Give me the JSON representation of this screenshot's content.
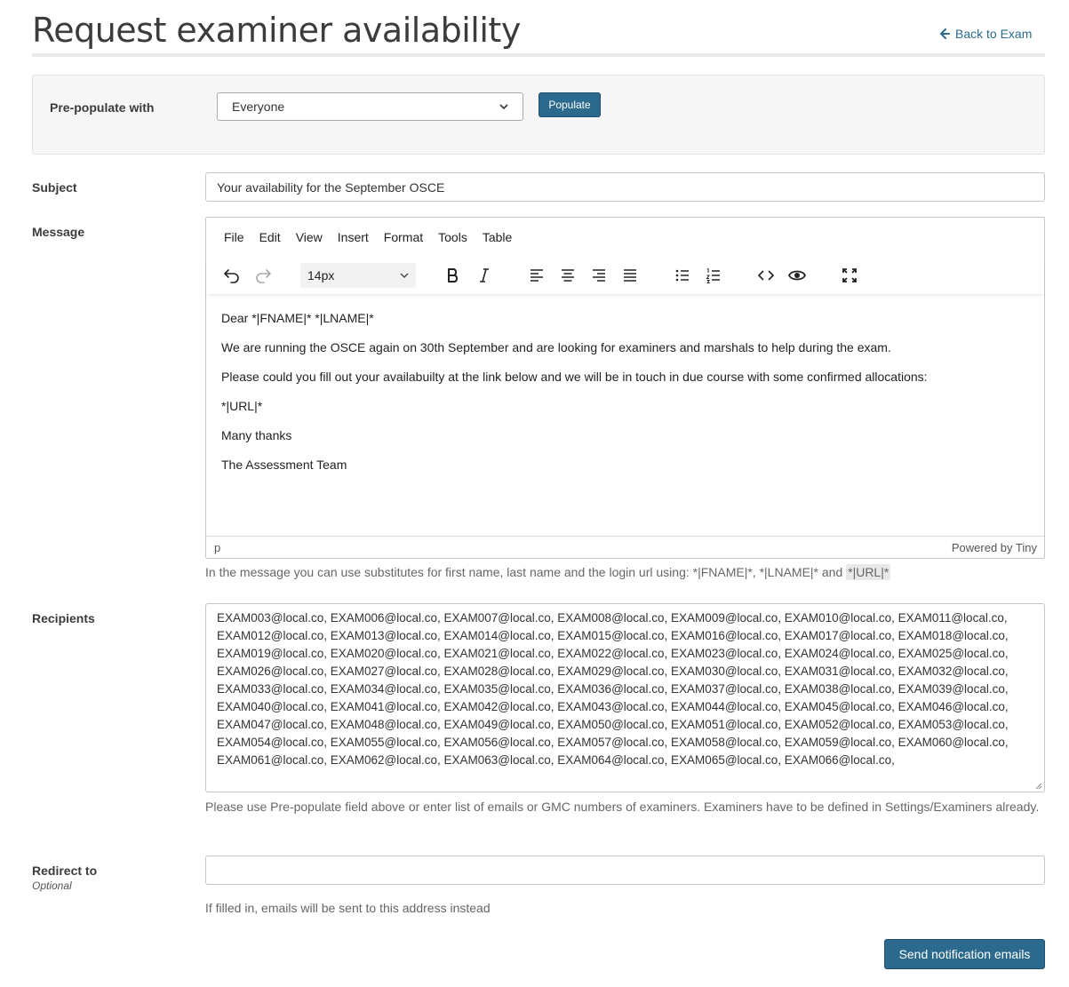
{
  "page": {
    "title": "Request examiner availability",
    "back_link": "Back to Exam"
  },
  "prepopulate": {
    "label": "Pre-populate with",
    "selected": "Everyone",
    "button": "Populate"
  },
  "subject": {
    "label": "Subject",
    "value": "Your availability for the September OSCE"
  },
  "message": {
    "label": "Message",
    "menu": [
      "File",
      "Edit",
      "View",
      "Insert",
      "Format",
      "Tools",
      "Table"
    ],
    "font_size": "14px",
    "paragraphs": [
      "Dear *|FNAME|* *|LNAME|*",
      "We are running the OSCE again on 30th September and are looking for examiners and marshals to help during the exam.",
      "Please could you fill out your availabuilty at the link below and we will be in touch in due course with some confirmed allocations:",
      "*|URL|*",
      "Many thanks",
      "The Assessment Team"
    ],
    "status_path": "p",
    "powered_by": "Powered by Tiny",
    "help_prefix": "In the message you can use substitutes for first name, last name and the login url using: *|FNAME|*, *|LNAME|* and",
    "help_tag": "*|URL|*"
  },
  "recipients": {
    "label": "Recipients",
    "value": "EXAM003@local.co, EXAM006@local.co, EXAM007@local.co, EXAM008@local.co, EXAM009@local.co, EXAM010@local.co, EXAM011@local.co, EXAM012@local.co, EXAM013@local.co, EXAM014@local.co, EXAM015@local.co, EXAM016@local.co, EXAM017@local.co, EXAM018@local.co, EXAM019@local.co, EXAM020@local.co, EXAM021@local.co, EXAM022@local.co, EXAM023@local.co, EXAM024@local.co, EXAM025@local.co, EXAM026@local.co, EXAM027@local.co, EXAM028@local.co, EXAM029@local.co, EXAM030@local.co, EXAM031@local.co, EXAM032@local.co, EXAM033@local.co, EXAM034@local.co, EXAM035@local.co, EXAM036@local.co, EXAM037@local.co, EXAM038@local.co, EXAM039@local.co, EXAM040@local.co, EXAM041@local.co, EXAM042@local.co, EXAM043@local.co, EXAM044@local.co, EXAM045@local.co, EXAM046@local.co, EXAM047@local.co, EXAM048@local.co, EXAM049@local.co, EXAM050@local.co, EXAM051@local.co, EXAM052@local.co, EXAM053@local.co, EXAM054@local.co, EXAM055@local.co, EXAM056@local.co, EXAM057@local.co, EXAM058@local.co, EXAM059@local.co, EXAM060@local.co, EXAM061@local.co, EXAM062@local.co, EXAM063@local.co, EXAM064@local.co, EXAM065@local.co, EXAM066@local.co,",
    "help": "Please use Pre-populate field above or enter list of emails or GMC numbers of examiners. Examiners have to be defined in Settings/Examiners already."
  },
  "redirect": {
    "label": "Redirect to",
    "optional": "Optional",
    "value": "",
    "help": "If filled in, emails will be sent to this address instead"
  },
  "submit": {
    "label": "Send notification emails"
  },
  "colors": {
    "primary": "#2b6a8c",
    "panel": "#f6f6f6"
  }
}
